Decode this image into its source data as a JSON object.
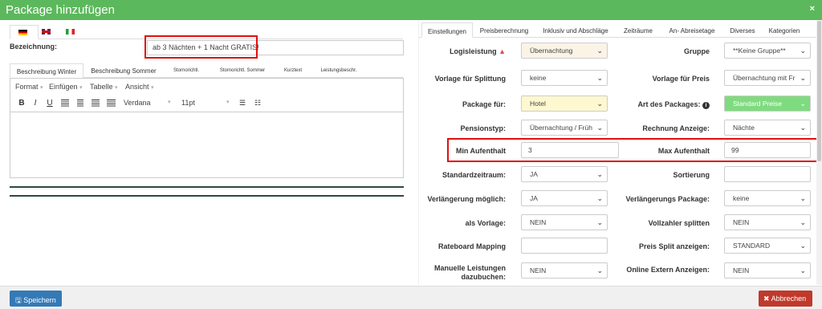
{
  "window": {
    "title": "Package hinzufügen",
    "close_glyph": "×"
  },
  "languages": [
    {
      "code": "de",
      "icon": "german-flag-icon",
      "active": true
    },
    {
      "code": "gb",
      "icon": "british-flag-icon",
      "active": false
    },
    {
      "code": "it",
      "icon": "italian-flag-icon",
      "active": false
    }
  ],
  "bezeichnung": {
    "label": "Bezeichnung:",
    "value": "ab 3 Nächten + 1 Nacht GRATIS!"
  },
  "description_tabs": [
    "Beschreibung Winter",
    "Beschreibung Sommer",
    "Stornorichtl.",
    "Stornorichtl. Sommer",
    "Kurztext",
    "Leistungsbeschr."
  ],
  "editor": {
    "menu": [
      "Format",
      "Einfügen",
      "Tabelle",
      "Ansicht"
    ],
    "toolbar": {
      "bold": "B",
      "italic": "I",
      "underline": "U",
      "font": "Verdana",
      "size": "11pt"
    },
    "content": ""
  },
  "settings_tabs": [
    "Einstellungen",
    "Preisberechnung",
    "Inklusiv und Abschläge",
    "Zeiträume",
    "An- Abreisetage",
    "Diverses",
    "Kategorien"
  ],
  "fields": {
    "logisleistung": {
      "label": "Logisleistung",
      "value": "Übernachtung"
    },
    "gruppe": {
      "label": "Gruppe",
      "value": "**Keine Gruppe**"
    },
    "vorlage_splittung": {
      "label": "Vorlage für Splittung",
      "value": "keine"
    },
    "vorlage_preis": {
      "label": "Vorlage für Preis",
      "value": "Übernachtung mit Fr"
    },
    "package_fuer": {
      "label": "Package für:",
      "value": "Hotel"
    },
    "art_packages": {
      "label": "Art des Packages:",
      "value": "Standard Preise"
    },
    "pensionstyp": {
      "label": "Pensionstyp:",
      "value": "Übernachtung / Früh"
    },
    "rechnung_anzeige": {
      "label": "Rechnung Anzeige:",
      "value": "Nächte"
    },
    "min_aufenthalt": {
      "label": "Min Aufenthalt",
      "value": "3"
    },
    "max_aufenthalt": {
      "label": "Max Aufenthalt",
      "value": "99"
    },
    "standardzeitraum": {
      "label": "Standardzeitraum:",
      "value": "JA"
    },
    "sortierung": {
      "label": "Sortierung",
      "value": ""
    },
    "verlaengerung_moeglich": {
      "label": "Verlängerung möglich:",
      "value": "JA"
    },
    "verlaengerungs_package": {
      "label": "Verlängerungs Package:",
      "value": "keine"
    },
    "als_vorlage": {
      "label": "als Vorlage:",
      "value": "NEIN"
    },
    "vollzahler_splitten": {
      "label": "Vollzahler splitten",
      "value": "NEIN"
    },
    "rateboard_mapping": {
      "label": "Rateboard Mapping",
      "value": ""
    },
    "preis_split": {
      "label": "Preis Split anzeigen:",
      "value": "STANDARD"
    },
    "manuelle_leistungen": {
      "label_line1": "Manuelle Leistungen",
      "label_line2": "dazubuchen:",
      "value": "NEIN"
    },
    "online_extern": {
      "label": "Online Extern Anzeigen:",
      "value": "NEIN"
    }
  },
  "footer": {
    "save": "Speichern",
    "cancel": "Abbrechen"
  },
  "colors": {
    "header": "#5cb85c",
    "save": "#337ab7",
    "cancel": "#c0392b",
    "highlight": "#e01010"
  }
}
